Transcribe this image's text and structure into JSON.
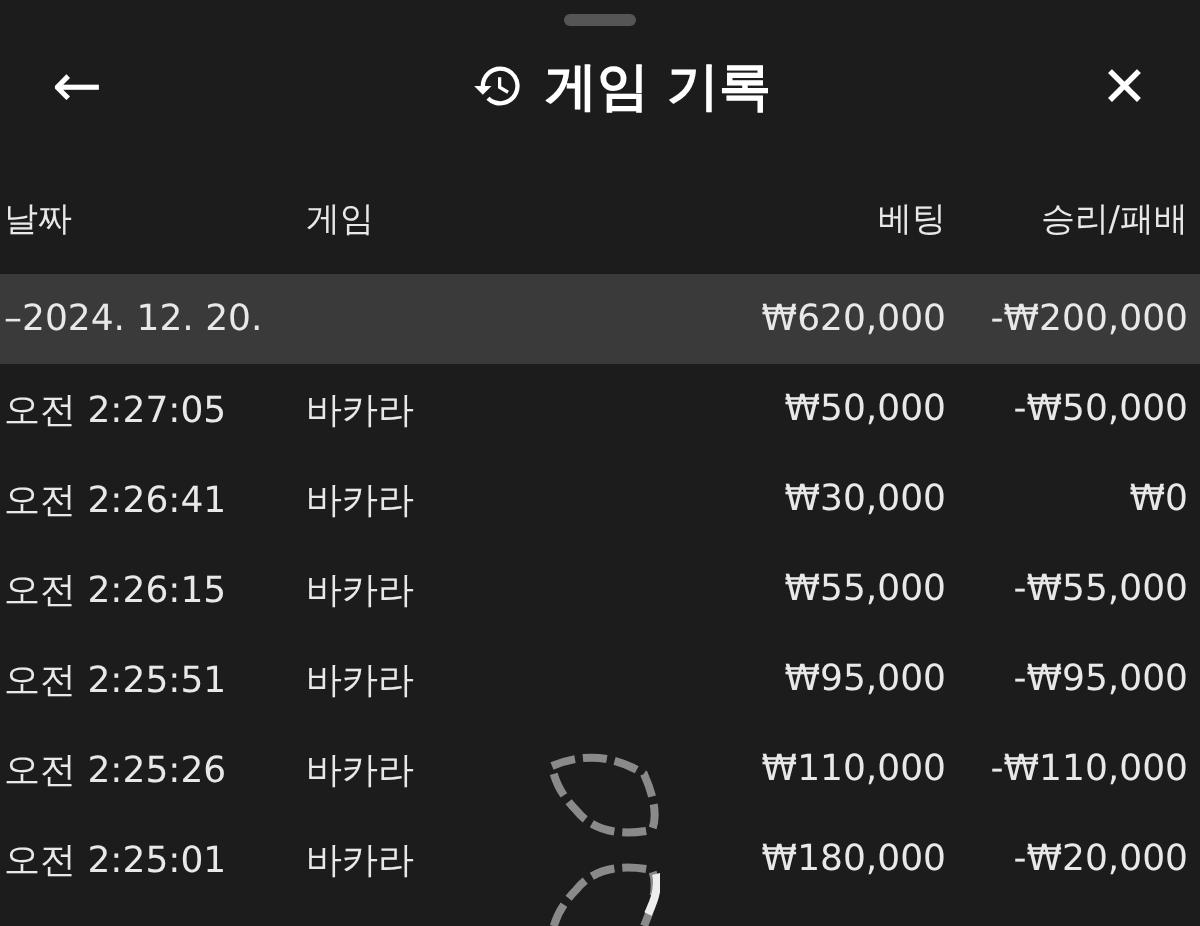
{
  "header": {
    "back": "←",
    "title": "게임 기록",
    "close": "✕"
  },
  "table": {
    "columns": [
      "날짜",
      "게임",
      "베팅",
      "승리/패배"
    ],
    "group": {
      "toggle": "–",
      "date": "2024. 12. 20.",
      "bet": "₩620,000",
      "result": "-₩200,000",
      "selected": true
    },
    "rows": [
      {
        "time": "오전 2:27:05",
        "game": "바카라",
        "bet": "₩50,000",
        "result": "-₩50,000"
      },
      {
        "time": "오전 2:26:41",
        "game": "바카라",
        "bet": "₩30,000",
        "result": "₩0"
      },
      {
        "time": "오전 2:26:15",
        "game": "바카라",
        "bet": "₩55,000",
        "result": "-₩55,000"
      },
      {
        "time": "오전 2:25:51",
        "game": "바카라",
        "bet": "₩95,000",
        "result": "-₩95,000"
      },
      {
        "time": "오전 2:25:26",
        "game": "바카라",
        "bet": "₩110,000",
        "result": "-₩110,000"
      },
      {
        "time": "오전 2:25:01",
        "game": "바카라",
        "bet": "₩180,000",
        "result": "-₩20,000"
      }
    ]
  },
  "loading": true
}
